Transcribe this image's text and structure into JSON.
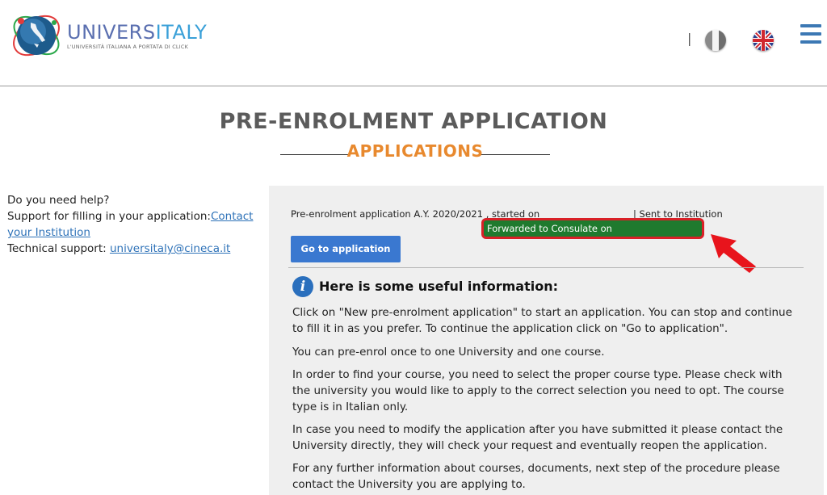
{
  "header": {
    "logo": {
      "name_part1": "UNIVERS",
      "name_part2": "ITALY",
      "tagline": "L'UNIVERSITÀ ITALIANA A PORTATA DI CLICK"
    },
    "separator": "|",
    "lang_icons": [
      "italian-flag-icon",
      "uk-flag-icon"
    ],
    "menu_icon": "hamburger-menu-icon"
  },
  "page": {
    "title": "PRE-ENROLMENT APPLICATION",
    "subtitle": "APPLICATIONS"
  },
  "help": {
    "question": "Do you need help?",
    "support_prefix": "Support for filling in your application:",
    "support_link": "Contact your Institution",
    "tech_prefix": "Technical support: ",
    "tech_link": "universitaly@cineca.it"
  },
  "application": {
    "summary": "Pre-enrolment application A.Y. 2020/2021 , started on",
    "sent": "| Sent to Institution",
    "forwarded": "Forwarded to Consulate on",
    "button": "Go to application"
  },
  "info": {
    "title": "Here is some useful information:",
    "paragraphs": [
      "Click on \"New pre-enrolment application\" to start an application. You can stop and continue to fill it in as you prefer. To continue the application click on \"Go to application\".",
      "You can pre-enrol once to one University and one course.",
      "In order to find your course, you need to select the proper course type. Please check with the university you would like to apply to the correct selection you need to opt. The course type is in Italian only.",
      "In case you need to modify the application after you have submitted it please contact the University directly, they will check your request and eventually reopen the application.",
      "For any further information about courses, documents, next step of the procedure please contact the University you are applying to."
    ]
  },
  "colors": {
    "accent_orange": "#e8892e",
    "button_blue": "#3a78d0",
    "highlight_green": "#1f7a2e",
    "annotation_red": "#d92027"
  }
}
